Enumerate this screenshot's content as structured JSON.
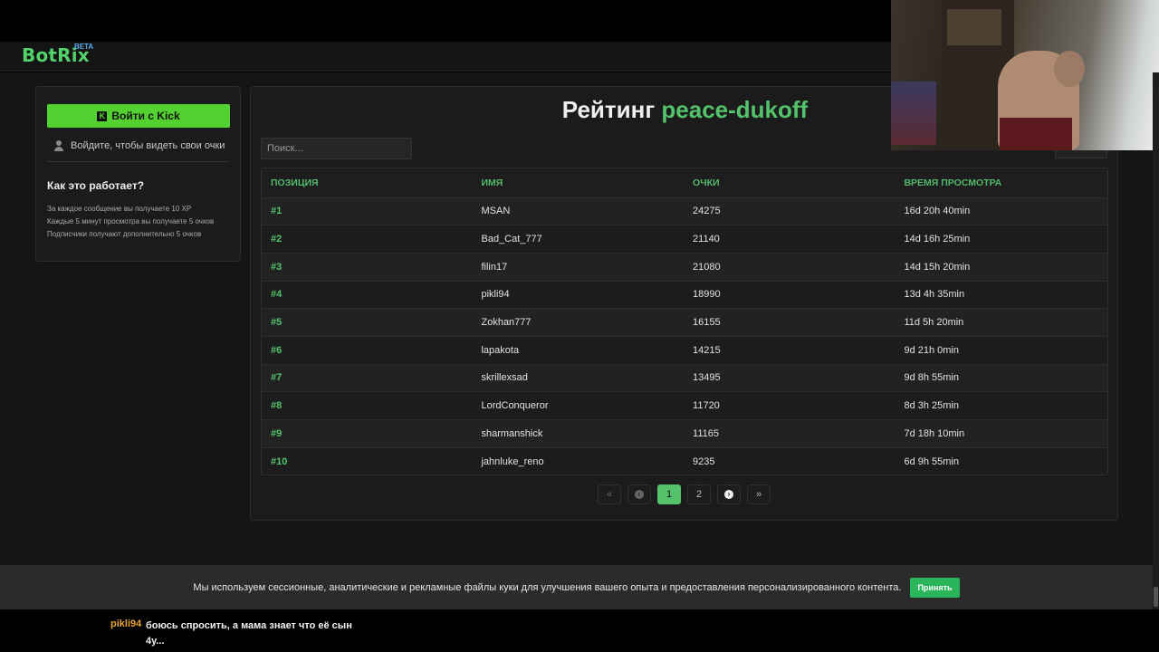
{
  "brand": {
    "name": "BotRix",
    "badge": "BETA"
  },
  "sidebar": {
    "login_button": "Войти с Kick",
    "kick_icon_glyph": "K",
    "login_hint": "Войдите, чтобы видеть свои очки",
    "how_title": "Как это работает?",
    "how_lines": [
      "За каждое сообщение вы получаете 10 XP",
      "Каждые 5 минут просмотра вы получаете 5 очков",
      "Подписчики получают дополнительно 5 очков"
    ]
  },
  "main": {
    "title_prefix": "Рейтинг",
    "title_channel": "peace-dukoff",
    "search_placeholder": "Поиск...",
    "columns": [
      "ПОЗИЦИЯ",
      "ИМЯ",
      "ОЧКИ",
      "ВРЕМЯ ПРОСМОТРА"
    ],
    "rows": [
      {
        "pos": "#1",
        "name": "MSAN",
        "points": "24275",
        "time": "16d 20h 40min"
      },
      {
        "pos": "#2",
        "name": "Bad_Cat_777",
        "points": "21140",
        "time": "14d 16h 25min"
      },
      {
        "pos": "#3",
        "name": "filin17",
        "points": "21080",
        "time": "14d 15h 20min"
      },
      {
        "pos": "#4",
        "name": "pikli94",
        "points": "18990",
        "time": "13d 4h 35min"
      },
      {
        "pos": "#5",
        "name": "Zokhan777",
        "points": "16155",
        "time": "11d 5h 20min"
      },
      {
        "pos": "#6",
        "name": "lapakota",
        "points": "14215",
        "time": "9d 21h 0min"
      },
      {
        "pos": "#7",
        "name": "skrillexsad",
        "points": "13495",
        "time": "9d 8h 55min"
      },
      {
        "pos": "#8",
        "name": "LordConqueror",
        "points": "11720",
        "time": "8d 3h 25min"
      },
      {
        "pos": "#9",
        "name": "sharmanshick",
        "points": "11165",
        "time": "7d 18h 10min"
      },
      {
        "pos": "#10",
        "name": "jahnluke_reno",
        "points": "9235",
        "time": "6d 9h 55min"
      }
    ],
    "pagination": {
      "first": "«",
      "prev": "‹",
      "pages": [
        "1",
        "2"
      ],
      "current": "1",
      "next": "›",
      "last": "»"
    }
  },
  "cookie_banner": {
    "text": "Мы используем сессионные, аналитические и рекламные файлы куки для улучшения вашего опыта и предоставления персонализированного контента.",
    "accept": "Принять"
  },
  "chat": {
    "user": "pikli94",
    "message": "боюсь спросить, а мама знает что её сын 4у..."
  }
}
